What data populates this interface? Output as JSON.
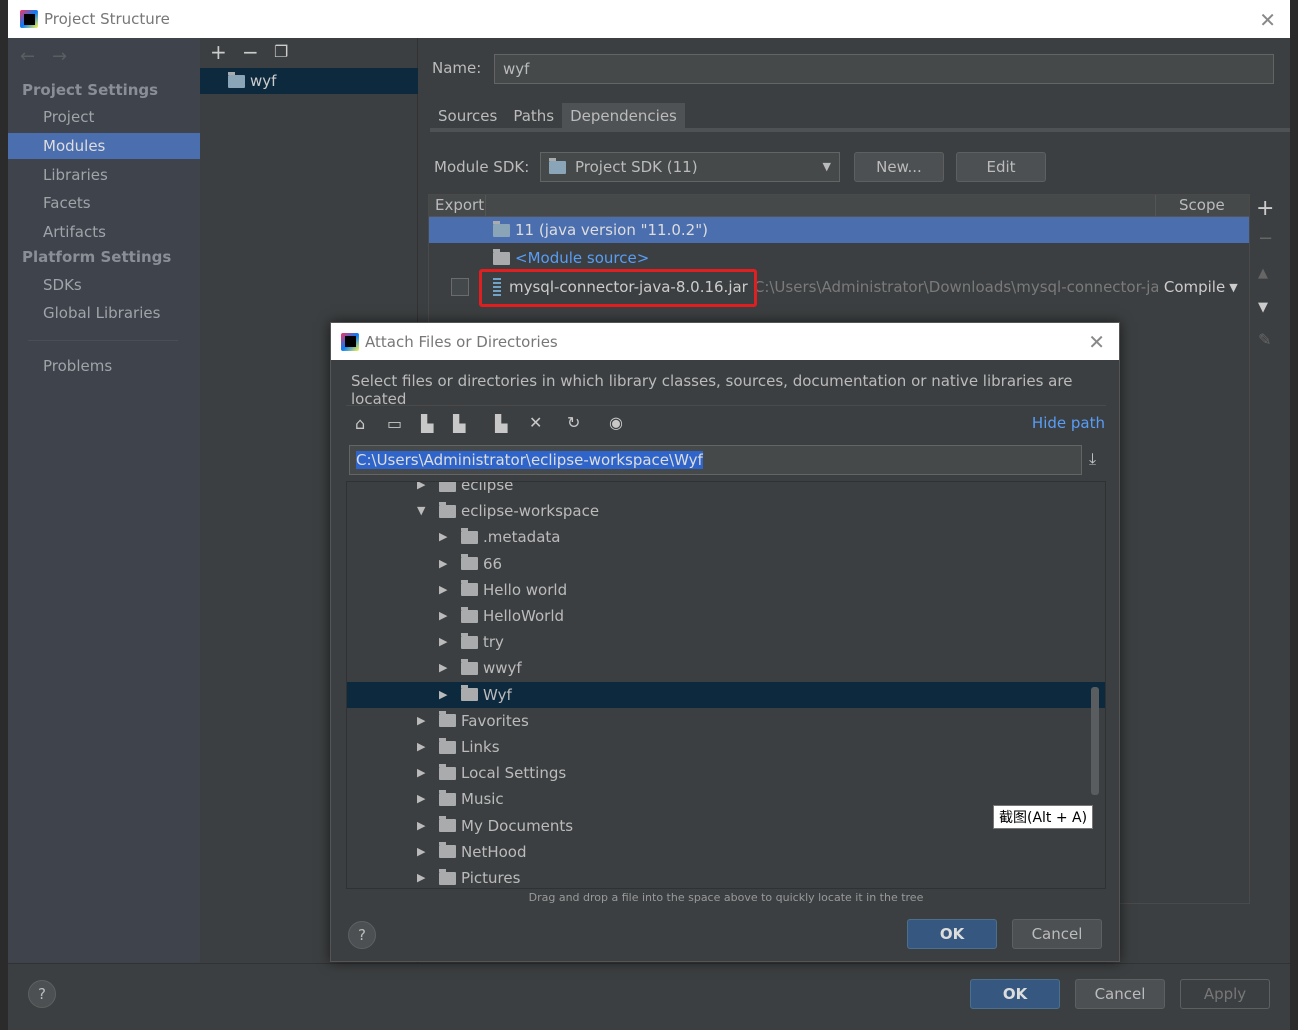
{
  "window": {
    "title": "Project Structure"
  },
  "sidebar": {
    "project_settings": "Project Settings",
    "items": [
      {
        "label": "Project"
      },
      {
        "label": "Modules",
        "selected": true
      },
      {
        "label": "Libraries"
      },
      {
        "label": "Facets"
      },
      {
        "label": "Artifacts"
      }
    ],
    "platform_settings": "Platform Settings",
    "platform_items": [
      {
        "label": "SDKs"
      },
      {
        "label": "Global Libraries"
      }
    ],
    "problems": "Problems"
  },
  "modules": {
    "items": [
      {
        "label": "wyf"
      }
    ]
  },
  "module": {
    "name_label": "Name:",
    "name_value": "wyf",
    "tabs": [
      {
        "label": "Sources"
      },
      {
        "label": "Paths"
      },
      {
        "label": "Dependencies",
        "active": true
      }
    ],
    "sdk_label": "Module SDK:",
    "sdk_value": "Project SDK (11)",
    "new_button": "New...",
    "edit_button": "Edit",
    "table": {
      "col_export": "Export",
      "col_scope": "Scope",
      "rows": [
        {
          "name": "11 (java version \"11.0.2\")"
        },
        {
          "name": "<Module source>"
        },
        {
          "name": "mysql-connector-java-8.0.16.jar",
          "path": "C:\\Users\\Administrator\\Downloads\\mysql-connector-ja",
          "scope": "Compile"
        }
      ]
    }
  },
  "footer": {
    "ok": "OK",
    "cancel": "Cancel",
    "apply": "Apply",
    "help": "?"
  },
  "dialog": {
    "title": "Attach Files or Directories",
    "description": "Select files or directories in which library classes, sources, documentation or native libraries are located",
    "hide_path": "Hide path",
    "path_value": "C:\\Users\\Administrator\\eclipse-workspace\\Wyf",
    "tree": [
      {
        "label": "eclipse",
        "level": 0,
        "expanded": false
      },
      {
        "label": "eclipse-workspace",
        "level": 0,
        "expanded": true
      },
      {
        "label": ".metadata",
        "level": 1
      },
      {
        "label": "66",
        "level": 1
      },
      {
        "label": "Hello world",
        "level": 1
      },
      {
        "label": "HelloWorld",
        "level": 1
      },
      {
        "label": "try",
        "level": 1
      },
      {
        "label": "wwyf",
        "level": 1
      },
      {
        "label": "Wyf",
        "level": 1,
        "selected": true
      },
      {
        "label": "Favorites",
        "level": 0
      },
      {
        "label": "Links",
        "level": 0
      },
      {
        "label": "Local Settings",
        "level": 0
      },
      {
        "label": "Music",
        "level": 0
      },
      {
        "label": "My Documents",
        "level": 0
      },
      {
        "label": "NetHood",
        "level": 0
      },
      {
        "label": "Pictures",
        "level": 0
      }
    ],
    "tooltip": "截图(Alt + A)",
    "hint": "Drag and drop a file into the space above to quickly locate it in the tree",
    "ok": "OK",
    "cancel": "Cancel",
    "help": "?"
  },
  "colors": {
    "selection": "#4b6eaf",
    "tree_selection": "#0d293e",
    "link": "#589df6",
    "highlight_box": "#e02020"
  }
}
